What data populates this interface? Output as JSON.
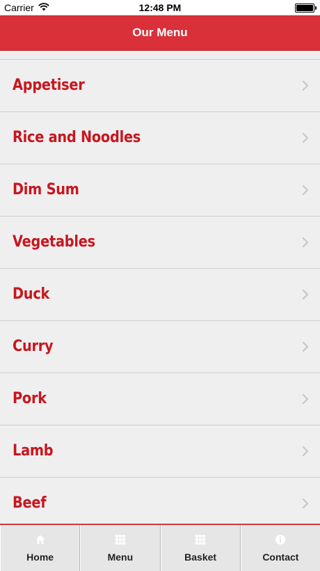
{
  "status": {
    "carrier": "Carrier",
    "time": "12:48 PM"
  },
  "header": {
    "title": "Our Menu"
  },
  "menu": {
    "items": [
      {
        "label": "Appetiser"
      },
      {
        "label": "Rice and Noodles"
      },
      {
        "label": "Dim Sum"
      },
      {
        "label": "Vegetables"
      },
      {
        "label": "Duck"
      },
      {
        "label": "Curry"
      },
      {
        "label": "Pork"
      },
      {
        "label": "Lamb"
      },
      {
        "label": "Beef"
      }
    ]
  },
  "tabs": [
    {
      "label": "Home",
      "icon": "home-icon"
    },
    {
      "label": "Menu",
      "icon": "grid-icon"
    },
    {
      "label": "Basket",
      "icon": "grid-icon"
    },
    {
      "label": "Contact",
      "icon": "info-icon"
    }
  ],
  "colors": {
    "accent": "#d9303a",
    "item_text": "#c8161e",
    "background": "#efeff0"
  }
}
